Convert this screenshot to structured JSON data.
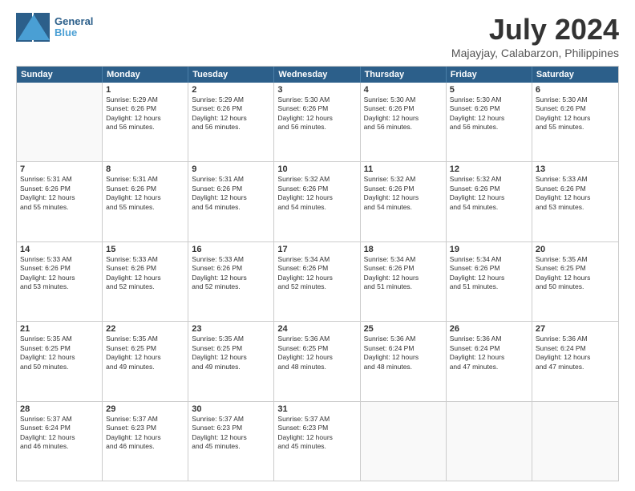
{
  "header": {
    "logo_line1": "General",
    "logo_line2": "Blue",
    "title": "July 2024",
    "subtitle": "Majayjay, Calabarzon, Philippines"
  },
  "weekdays": [
    "Sunday",
    "Monday",
    "Tuesday",
    "Wednesday",
    "Thursday",
    "Friday",
    "Saturday"
  ],
  "weeks": [
    [
      {
        "day": "",
        "info": ""
      },
      {
        "day": "1",
        "info": "Sunrise: 5:29 AM\nSunset: 6:26 PM\nDaylight: 12 hours\nand 56 minutes."
      },
      {
        "day": "2",
        "info": "Sunrise: 5:29 AM\nSunset: 6:26 PM\nDaylight: 12 hours\nand 56 minutes."
      },
      {
        "day": "3",
        "info": "Sunrise: 5:30 AM\nSunset: 6:26 PM\nDaylight: 12 hours\nand 56 minutes."
      },
      {
        "day": "4",
        "info": "Sunrise: 5:30 AM\nSunset: 6:26 PM\nDaylight: 12 hours\nand 56 minutes."
      },
      {
        "day": "5",
        "info": "Sunrise: 5:30 AM\nSunset: 6:26 PM\nDaylight: 12 hours\nand 56 minutes."
      },
      {
        "day": "6",
        "info": "Sunrise: 5:30 AM\nSunset: 6:26 PM\nDaylight: 12 hours\nand 55 minutes."
      }
    ],
    [
      {
        "day": "7",
        "info": "Sunrise: 5:31 AM\nSunset: 6:26 PM\nDaylight: 12 hours\nand 55 minutes."
      },
      {
        "day": "8",
        "info": "Sunrise: 5:31 AM\nSunset: 6:26 PM\nDaylight: 12 hours\nand 55 minutes."
      },
      {
        "day": "9",
        "info": "Sunrise: 5:31 AM\nSunset: 6:26 PM\nDaylight: 12 hours\nand 54 minutes."
      },
      {
        "day": "10",
        "info": "Sunrise: 5:32 AM\nSunset: 6:26 PM\nDaylight: 12 hours\nand 54 minutes."
      },
      {
        "day": "11",
        "info": "Sunrise: 5:32 AM\nSunset: 6:26 PM\nDaylight: 12 hours\nand 54 minutes."
      },
      {
        "day": "12",
        "info": "Sunrise: 5:32 AM\nSunset: 6:26 PM\nDaylight: 12 hours\nand 54 minutes."
      },
      {
        "day": "13",
        "info": "Sunrise: 5:33 AM\nSunset: 6:26 PM\nDaylight: 12 hours\nand 53 minutes."
      }
    ],
    [
      {
        "day": "14",
        "info": "Sunrise: 5:33 AM\nSunset: 6:26 PM\nDaylight: 12 hours\nand 53 minutes."
      },
      {
        "day": "15",
        "info": "Sunrise: 5:33 AM\nSunset: 6:26 PM\nDaylight: 12 hours\nand 52 minutes."
      },
      {
        "day": "16",
        "info": "Sunrise: 5:33 AM\nSunset: 6:26 PM\nDaylight: 12 hours\nand 52 minutes."
      },
      {
        "day": "17",
        "info": "Sunrise: 5:34 AM\nSunset: 6:26 PM\nDaylight: 12 hours\nand 52 minutes."
      },
      {
        "day": "18",
        "info": "Sunrise: 5:34 AM\nSunset: 6:26 PM\nDaylight: 12 hours\nand 51 minutes."
      },
      {
        "day": "19",
        "info": "Sunrise: 5:34 AM\nSunset: 6:26 PM\nDaylight: 12 hours\nand 51 minutes."
      },
      {
        "day": "20",
        "info": "Sunrise: 5:35 AM\nSunset: 6:25 PM\nDaylight: 12 hours\nand 50 minutes."
      }
    ],
    [
      {
        "day": "21",
        "info": "Sunrise: 5:35 AM\nSunset: 6:25 PM\nDaylight: 12 hours\nand 50 minutes."
      },
      {
        "day": "22",
        "info": "Sunrise: 5:35 AM\nSunset: 6:25 PM\nDaylight: 12 hours\nand 49 minutes."
      },
      {
        "day": "23",
        "info": "Sunrise: 5:35 AM\nSunset: 6:25 PM\nDaylight: 12 hours\nand 49 minutes."
      },
      {
        "day": "24",
        "info": "Sunrise: 5:36 AM\nSunset: 6:25 PM\nDaylight: 12 hours\nand 48 minutes."
      },
      {
        "day": "25",
        "info": "Sunrise: 5:36 AM\nSunset: 6:24 PM\nDaylight: 12 hours\nand 48 minutes."
      },
      {
        "day": "26",
        "info": "Sunrise: 5:36 AM\nSunset: 6:24 PM\nDaylight: 12 hours\nand 47 minutes."
      },
      {
        "day": "27",
        "info": "Sunrise: 5:36 AM\nSunset: 6:24 PM\nDaylight: 12 hours\nand 47 minutes."
      }
    ],
    [
      {
        "day": "28",
        "info": "Sunrise: 5:37 AM\nSunset: 6:24 PM\nDaylight: 12 hours\nand 46 minutes."
      },
      {
        "day": "29",
        "info": "Sunrise: 5:37 AM\nSunset: 6:23 PM\nDaylight: 12 hours\nand 46 minutes."
      },
      {
        "day": "30",
        "info": "Sunrise: 5:37 AM\nSunset: 6:23 PM\nDaylight: 12 hours\nand 45 minutes."
      },
      {
        "day": "31",
        "info": "Sunrise: 5:37 AM\nSunset: 6:23 PM\nDaylight: 12 hours\nand 45 minutes."
      },
      {
        "day": "",
        "info": ""
      },
      {
        "day": "",
        "info": ""
      },
      {
        "day": "",
        "info": ""
      }
    ]
  ]
}
